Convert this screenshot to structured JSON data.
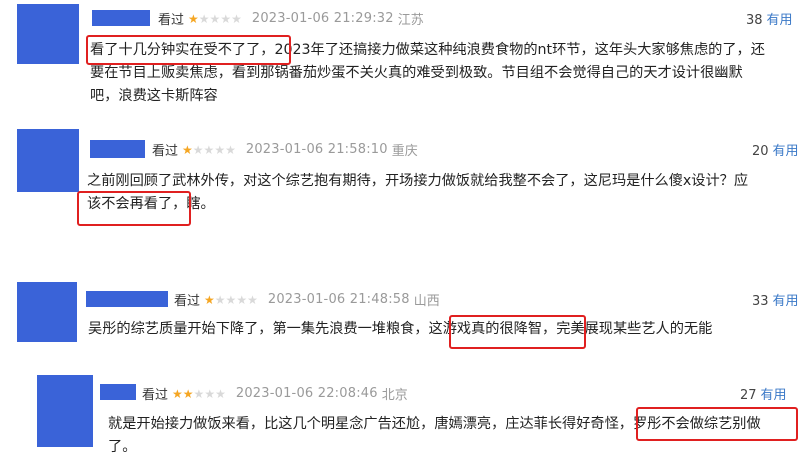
{
  "comments": [
    {
      "status": "看过",
      "rating": 1,
      "timestamp": "2023-01-06 21:29:32",
      "location": "江苏",
      "useful_count": "38",
      "useful_label": "有用",
      "text_lines": [
        "看了十几分钟实在受不了了，2023年了还搞接力做菜这种纯浪费食物的nt环节，这年头大家够焦虑的了，还",
        "要在节目上贩卖焦虑，看到那锅番茄炒蛋不关火真的难受到极致。节目组不会觉得自己的天才设计很幽默",
        "吧，浪费这卡斯阵容"
      ]
    },
    {
      "status": "看过",
      "rating": 1,
      "timestamp": "2023-01-06 21:58:10",
      "location": "重庆",
      "useful_count": "20",
      "useful_label": "有用",
      "text_lines": [
        "之前刚回顾了武林外传，对这个综艺抱有期待，开场接力做饭就给我整不会了，这尼玛是什么傻x设计？应",
        "该不会再看了，瞎。"
      ]
    },
    {
      "status": "看过",
      "rating": 1,
      "timestamp": "2023-01-06 21:48:58",
      "location": "山西",
      "useful_count": "33",
      "useful_label": "有用",
      "text_lines": [
        "吴彤的综艺质量开始下降了，第一集先浪费一堆粮食，这游戏真的很降智，完美展现某些艺人的无能"
      ]
    },
    {
      "status": "看过",
      "rating": 2,
      "timestamp": "2023-01-06 22:08:46",
      "location": "北京",
      "useful_count": "27",
      "useful_label": "有用",
      "text_lines": [
        "就是开始接力做饭来看，比这几个明星念广告还尬，唐嫣漂亮，庄达菲长得好奇怪，罗彤不会做综艺别做",
        "了。"
      ]
    }
  ],
  "colors": {
    "avatar": "#3a63d8",
    "star_on": "#f5a623",
    "star_off": "#d9d9d9",
    "useful_link": "#3a78c7",
    "highlight": "#e02020"
  }
}
